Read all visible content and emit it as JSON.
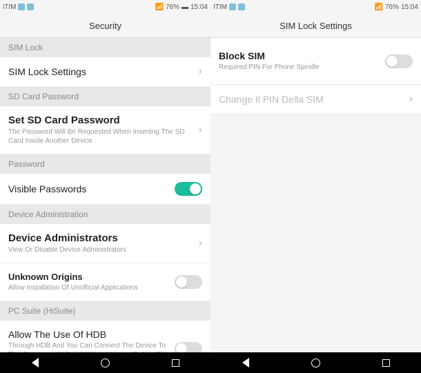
{
  "status": {
    "carrier": "ITIM",
    "carrier2": "iTIM",
    "battery": "76%",
    "time": "15:04"
  },
  "left": {
    "header": "Security",
    "sec_simlock": "SIM Lock",
    "row_simlock_settings": "SIM Lock Settings",
    "sec_sdcard": "SD Card Password",
    "row_setpw_title": "Set SD Card Password",
    "row_setpw_sub": "The Password Will Be Requested When Inserting The SD Card Inside Another Device",
    "sec_password": "Password",
    "row_visible_pw": "Visible Passwords",
    "sec_devadmin": "Device Administration",
    "row_devadmin_title": "Device Administrators",
    "row_devadmin_sub": "View Or Disable Device Administrators",
    "row_unknown_title": "Unknown Origins",
    "row_unknown_sub": "Allow Installation Of Unofficial Applications",
    "sec_pcsuite": "PC Suite (HiSuite)",
    "row_hdb_title": "Allow The Use Of HDB",
    "row_hdb_sub": "Through HDB And You Can Connect The Device To The Computer, (HiSuite) Without Having To Use The di debug USB"
  },
  "right": {
    "header": "SIM Lock Settings",
    "row_block_title": "Block SIM",
    "row_block_sub": "Required PIN For Phone Spindle",
    "row_changepin": "Change Il PIN Della SIM"
  }
}
